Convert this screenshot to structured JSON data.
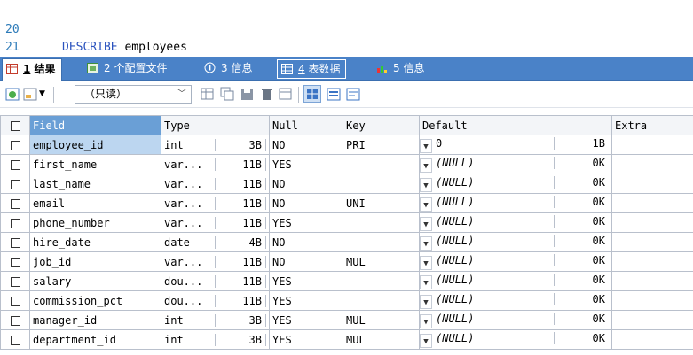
{
  "editor": {
    "lines": [
      {
        "number": "20",
        "keyword": "DESCRIBE",
        "identifier": "employees"
      },
      {
        "number": "21",
        "keyword": "",
        "identifier": ""
      }
    ]
  },
  "tabs": [
    {
      "num": "1",
      "label": "结果",
      "icon": "grid-icon",
      "active": true
    },
    {
      "num": "2",
      "label": "个配置文件",
      "icon": "profile-icon",
      "active": false
    },
    {
      "num": "3",
      "label": "信息",
      "icon": "info-icon",
      "active": false
    },
    {
      "num": "4",
      "label": "表数据",
      "icon": "table-icon",
      "active": false
    },
    {
      "num": "5",
      "label": "信息",
      "icon": "chart-icon",
      "active": false
    }
  ],
  "toolbar": {
    "mode_select": "（只读）"
  },
  "grid": {
    "columns": [
      "Field",
      "Type",
      "Null",
      "Key",
      "Default",
      "Extra"
    ],
    "rows": [
      {
        "field": "employee_id",
        "type": "int",
        "type_size": "3B",
        "null": "NO",
        "key": "PRI",
        "default": "0",
        "default_size": "1B",
        "extra": "",
        "selected": true
      },
      {
        "field": "first_name",
        "type": "var...",
        "type_size": "11B",
        "null": "YES",
        "key": "",
        "default": "(NULL)",
        "default_size": "0K",
        "extra": ""
      },
      {
        "field": "last_name",
        "type": "var...",
        "type_size": "11B",
        "null": "NO",
        "key": "",
        "default": "(NULL)",
        "default_size": "0K",
        "extra": ""
      },
      {
        "field": "email",
        "type": "var...",
        "type_size": "11B",
        "null": "NO",
        "key": "UNI",
        "default": "(NULL)",
        "default_size": "0K",
        "extra": ""
      },
      {
        "field": "phone_number",
        "type": "var...",
        "type_size": "11B",
        "null": "YES",
        "key": "",
        "default": "(NULL)",
        "default_size": "0K",
        "extra": ""
      },
      {
        "field": "hire_date",
        "type": "date",
        "type_size": "4B",
        "null": "NO",
        "key": "",
        "default": "(NULL)",
        "default_size": "0K",
        "extra": ""
      },
      {
        "field": "job_id",
        "type": "var...",
        "type_size": "11B",
        "null": "NO",
        "key": "MUL",
        "default": "(NULL)",
        "default_size": "0K",
        "extra": ""
      },
      {
        "field": "salary",
        "type": "dou...",
        "type_size": "11B",
        "null": "YES",
        "key": "",
        "default": "(NULL)",
        "default_size": "0K",
        "extra": ""
      },
      {
        "field": "commission_pct",
        "type": "dou...",
        "type_size": "11B",
        "null": "YES",
        "key": "",
        "default": "(NULL)",
        "default_size": "0K",
        "extra": ""
      },
      {
        "field": "manager_id",
        "type": "int",
        "type_size": "3B",
        "null": "YES",
        "key": "MUL",
        "default": "(NULL)",
        "default_size": "0K",
        "extra": ""
      },
      {
        "field": "department_id",
        "type": "int",
        "type_size": "3B",
        "null": "YES",
        "key": "MUL",
        "default": "(NULL)",
        "default_size": "0K",
        "extra": ""
      }
    ]
  },
  "colors": {
    "tab_bar": "#4a82c8",
    "selected_row": "#bcd6f0",
    "field_header": "#6a9fd6",
    "line_number": "#2b7ab8",
    "keyword": "#2a52be"
  }
}
